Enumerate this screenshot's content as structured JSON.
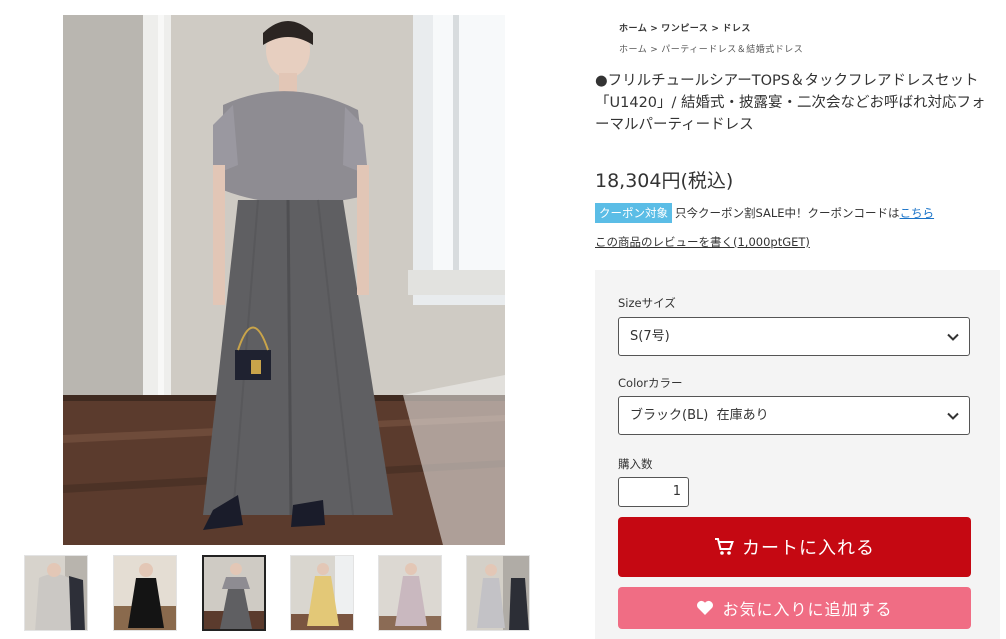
{
  "breadcrumbs": {
    "primary": [
      "ホーム",
      "ワンピース",
      "ドレス"
    ],
    "secondary": [
      "ホーム",
      "パーティードレス＆結婚式ドレス"
    ],
    "separator": ">"
  },
  "product": {
    "title": "●フリルチュールシアーTOPS＆タックフレアドレスセット「U1420」/ 結婚式・披露宴・二次会などお呼ばれ対応フォーマルパーティードレス",
    "price": "18,304円(税込)"
  },
  "coupon": {
    "badge": "クーポン対象",
    "text": "只今クーポン割SALE中！クーポンコードは",
    "link": "こちら"
  },
  "review_link": "この商品のレビューを書く(1,000ptGET)",
  "options": {
    "size_label": "Sizeサイズ",
    "size_value": "S(7号)",
    "color_label": "Colorカラー",
    "color_value": "ブラック(BL)  在庫あり",
    "qty_label": "購入数",
    "qty_value": "1"
  },
  "buttons": {
    "cart": "カートに入れる",
    "favorite": "お気に入りに追加する"
  },
  "colors": {
    "cart_button": "#c50812",
    "favorite_button": "#f06d84",
    "coupon_badge": "#5bbde6",
    "link": "#1a73c8",
    "dress_gray": "#5f5f62"
  },
  "icons": {
    "cart": "cart-icon",
    "heart": "heart-icon",
    "chevron": "chevron-down-icon"
  }
}
